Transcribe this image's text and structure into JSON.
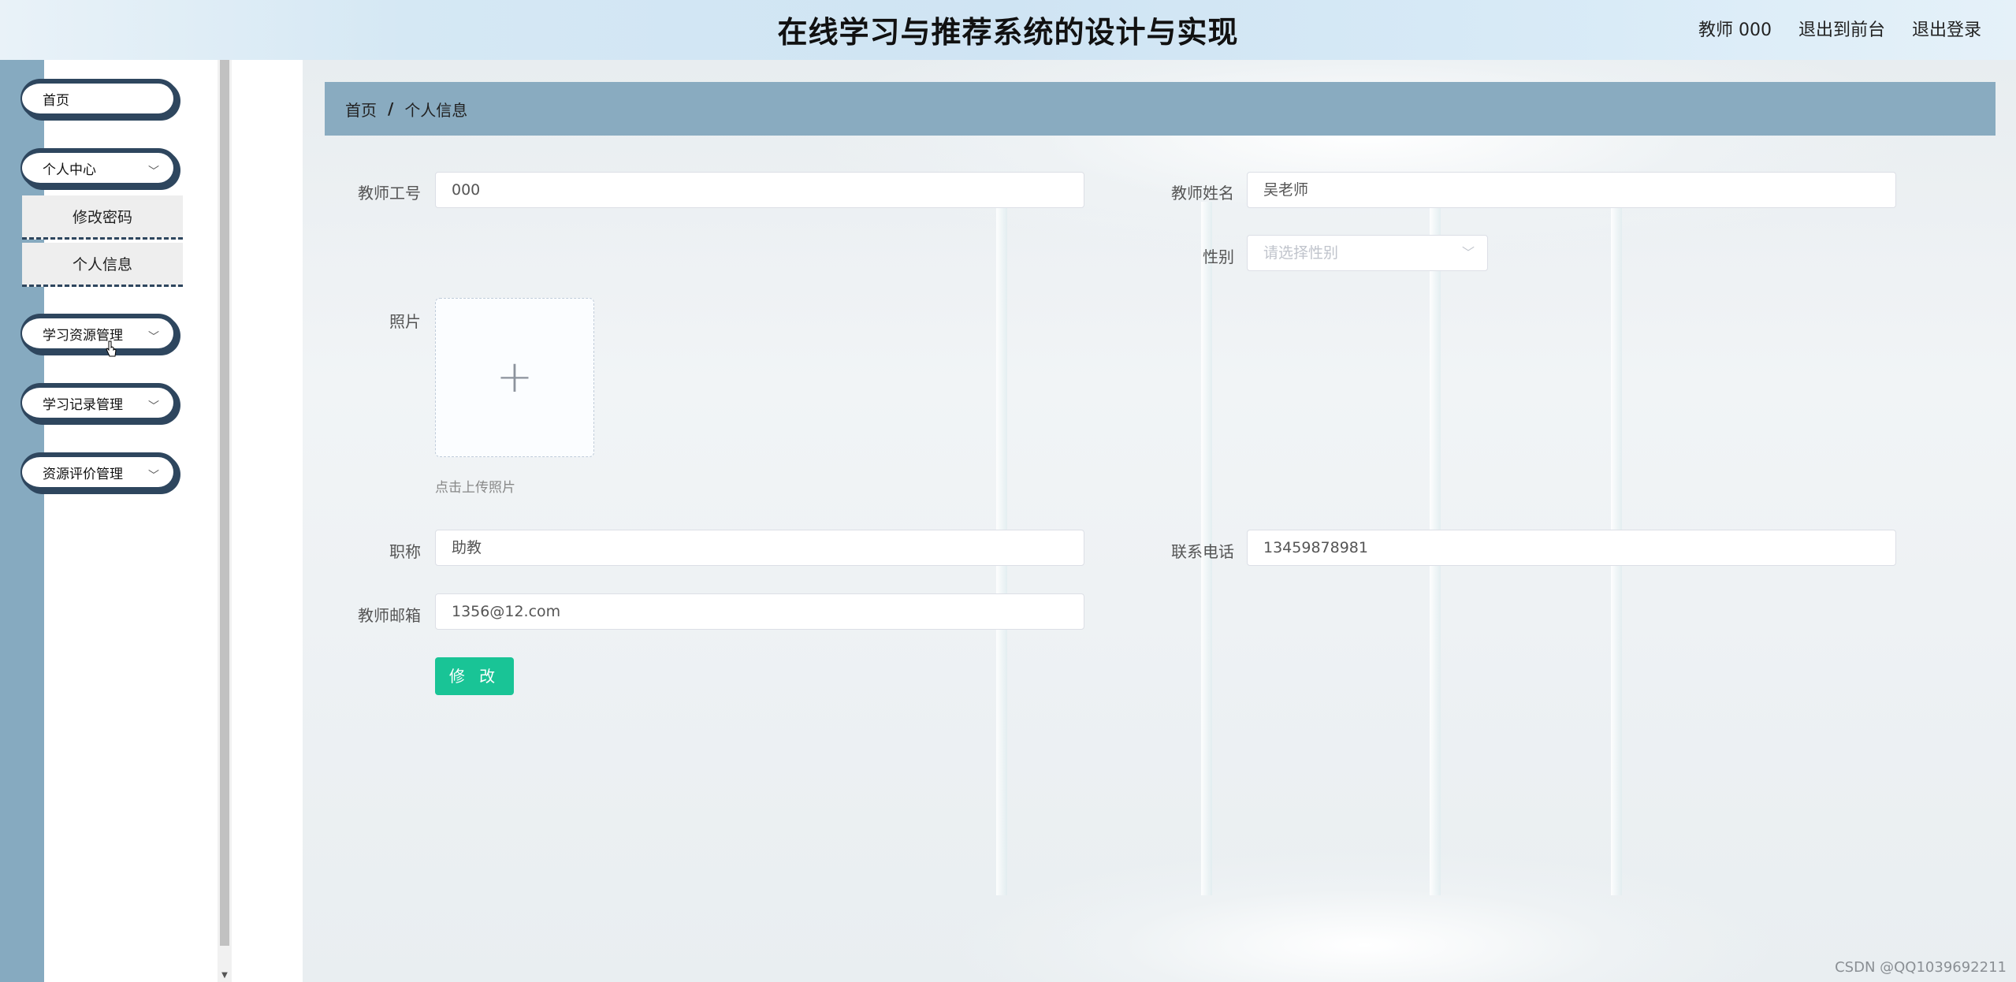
{
  "header": {
    "title": "在线学习与推荐系统的设计与实现",
    "user": "教师 000",
    "to_front": "退出到前台",
    "logout": "退出登录"
  },
  "sidebar": {
    "home": "首页",
    "personal_center": "个人中心",
    "change_password": "修改密码",
    "personal_info": "个人信息",
    "resource_mgmt": "学习资源管理",
    "record_mgmt": "学习记录管理",
    "evaluation_mgmt": "资源评价管理"
  },
  "breadcrumb": {
    "home": "首页",
    "sep": "/",
    "current": "个人信息"
  },
  "form": {
    "teacher_id_label": "教师工号",
    "teacher_id_value": "000",
    "teacher_name_label": "教师姓名",
    "teacher_name_value": "吴老师",
    "gender_label": "性别",
    "gender_placeholder": "请选择性别",
    "photo_label": "照片",
    "upload_hint": "点击上传照片",
    "title_label": "职称",
    "title_value": "助教",
    "phone_label": "联系电话",
    "phone_value": "13459878981",
    "email_label": "教师邮箱",
    "email_value": "1356@12.com",
    "submit": "修 改"
  },
  "watermark": "CSDN @QQ1039692211",
  "colors": {
    "sidebar_accent": "#86aac0",
    "menu_border": "#2e465e",
    "breadcrumb_bg": "#89abc0",
    "submit_bg": "#19c496"
  }
}
